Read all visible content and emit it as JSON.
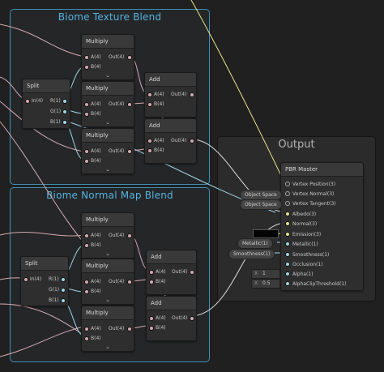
{
  "groups": {
    "texture_title": "Biome Texture Blend",
    "normal_title": "Biome Normal Map Blend"
  },
  "nodes": {
    "multiply_title": "Multiply",
    "add_title": "Add",
    "split_title": "Split",
    "in_a": "A(4)",
    "in_b": "B(4)",
    "out": "Out(4)",
    "split_in": "In(4)",
    "split_r": "R(1)",
    "split_g": "G(1)",
    "split_b": "B(1)",
    "collapse_glyph": "⌄"
  },
  "output": {
    "panel_title": "Output",
    "master_title": "PBR Master",
    "ports": [
      "Vertex Position(3)",
      "Vertex Normal(3)",
      "Vertex Tangent(3)",
      "Albedo(3)",
      "Normal(3)",
      "Emission(3)",
      "Metallic(1)",
      "Smoothness(1)",
      "Occlusion(1)",
      "Alpha(1)",
      "AlphaClipThreshold(1)"
    ],
    "object_space_1": "Object Space",
    "object_space_2": "Object Space",
    "metallic_pill": "Metallic(1)",
    "smoothness_pill": "Smoothness(1)",
    "x_label": "X",
    "alpha_value": "1",
    "clip_value": "0.5"
  },
  "colors": {
    "group_border": "#3f8fb5",
    "group_title": "#56b3e0",
    "wire_pink": "#d5a9b0",
    "wire_blue": "#9fd6ea",
    "wire_yellow": "#e8e38a",
    "wire_white": "#dcdcdc"
  }
}
